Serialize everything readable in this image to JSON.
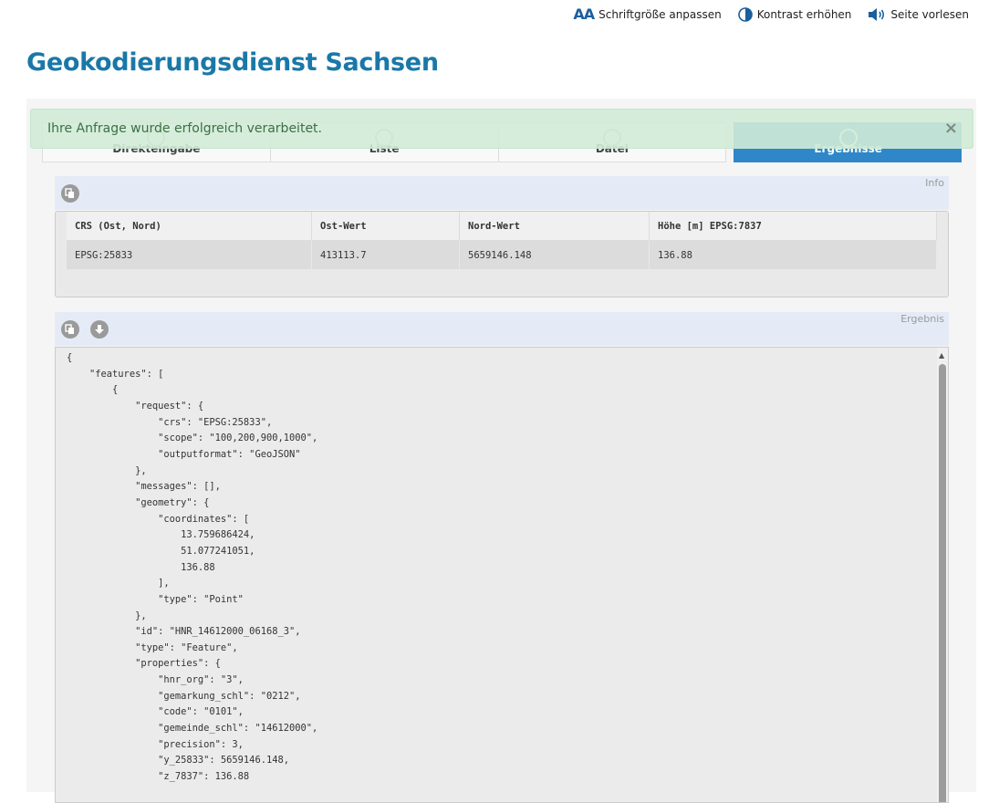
{
  "toolbar": {
    "font_size_label": "Schriftgröße anpassen",
    "contrast_label": "Kontrast erhöhen",
    "read_aloud_label": "Seite vorlesen"
  },
  "page_title": "Geokodierungsdienst Sachsen",
  "tabs": [
    {
      "label": "Direkteingabe",
      "active": false
    },
    {
      "label": "Liste",
      "active": false
    },
    {
      "label": "Datei",
      "active": false
    },
    {
      "label": "Ergebnisse",
      "active": true
    }
  ],
  "alert": {
    "message": "Ihre Anfrage wurde erfolgreich verarbeitet.",
    "close": "×"
  },
  "info": {
    "label": "Info",
    "columns": [
      "CRS (Ost, Nord)",
      "Ost-Wert",
      "Nord-Wert",
      "Höhe [m] EPSG:7837"
    ],
    "row": [
      "EPSG:25833",
      "413113.7",
      "5659146.148",
      "136.88"
    ]
  },
  "result": {
    "label": "Ergebnis",
    "json_text": "{\n    \"features\": [\n        {\n            \"request\": {\n                \"crs\": \"EPSG:25833\",\n                \"scope\": \"100,200,900,1000\",\n                \"outputformat\": \"GeoJSON\"\n            },\n            \"messages\": [],\n            \"geometry\": {\n                \"coordinates\": [\n                    13.759686424,\n                    51.077241051,\n                    136.88\n                ],\n                \"type\": \"Point\"\n            },\n            \"id\": \"HNR_14612000_06168_3\",\n            \"type\": \"Feature\",\n            \"properties\": {\n                \"hnr_org\": \"3\",\n                \"gemarkung_schl\": \"0212\",\n                \"code\": \"0101\",\n                \"gemeinde_schl\": \"14612000\",\n                \"precision\": 3,\n                \"y_25833\": 5659146.148,\n                \"z_7837\": 136.88"
  },
  "colors": {
    "title": "#1a78a8",
    "active_tab": "#2f87c9",
    "alert_bg": "#d0ebd6",
    "section_head_bg": "#e5ebf6"
  }
}
